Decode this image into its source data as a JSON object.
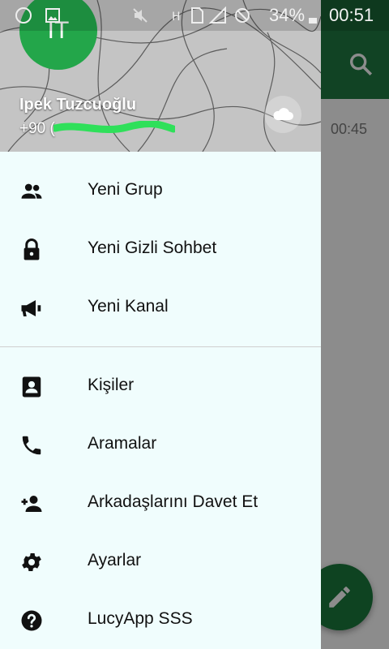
{
  "status_bar": {
    "battery": "34%",
    "time": "00:51"
  },
  "background_app": {
    "list_time": "00:45"
  },
  "drawer": {
    "avatar_initials": "IT",
    "user_name": "Ipek Tuzcuoğlu",
    "phone_prefix": "+90 (",
    "group1": [
      {
        "label": "Yeni Grup",
        "icon": "group-icon"
      },
      {
        "label": "Yeni Gizli Sohbet",
        "icon": "lock-icon"
      },
      {
        "label": "Yeni Kanal",
        "icon": "megaphone-icon"
      }
    ],
    "group2": [
      {
        "label": "Kişiler",
        "icon": "contacts-icon"
      },
      {
        "label": "Aramalar",
        "icon": "phone-icon"
      },
      {
        "label": "Arkadaşlarını Davet Et",
        "icon": "add-person-icon"
      },
      {
        "label": "Ayarlar",
        "icon": "settings-icon"
      },
      {
        "label": "LucyApp SSS",
        "icon": "help-icon"
      }
    ]
  },
  "colors": {
    "accent_green": "#1f7a43",
    "avatar_green": "#23a64a",
    "drawer_bg": "#f0fdfd"
  }
}
